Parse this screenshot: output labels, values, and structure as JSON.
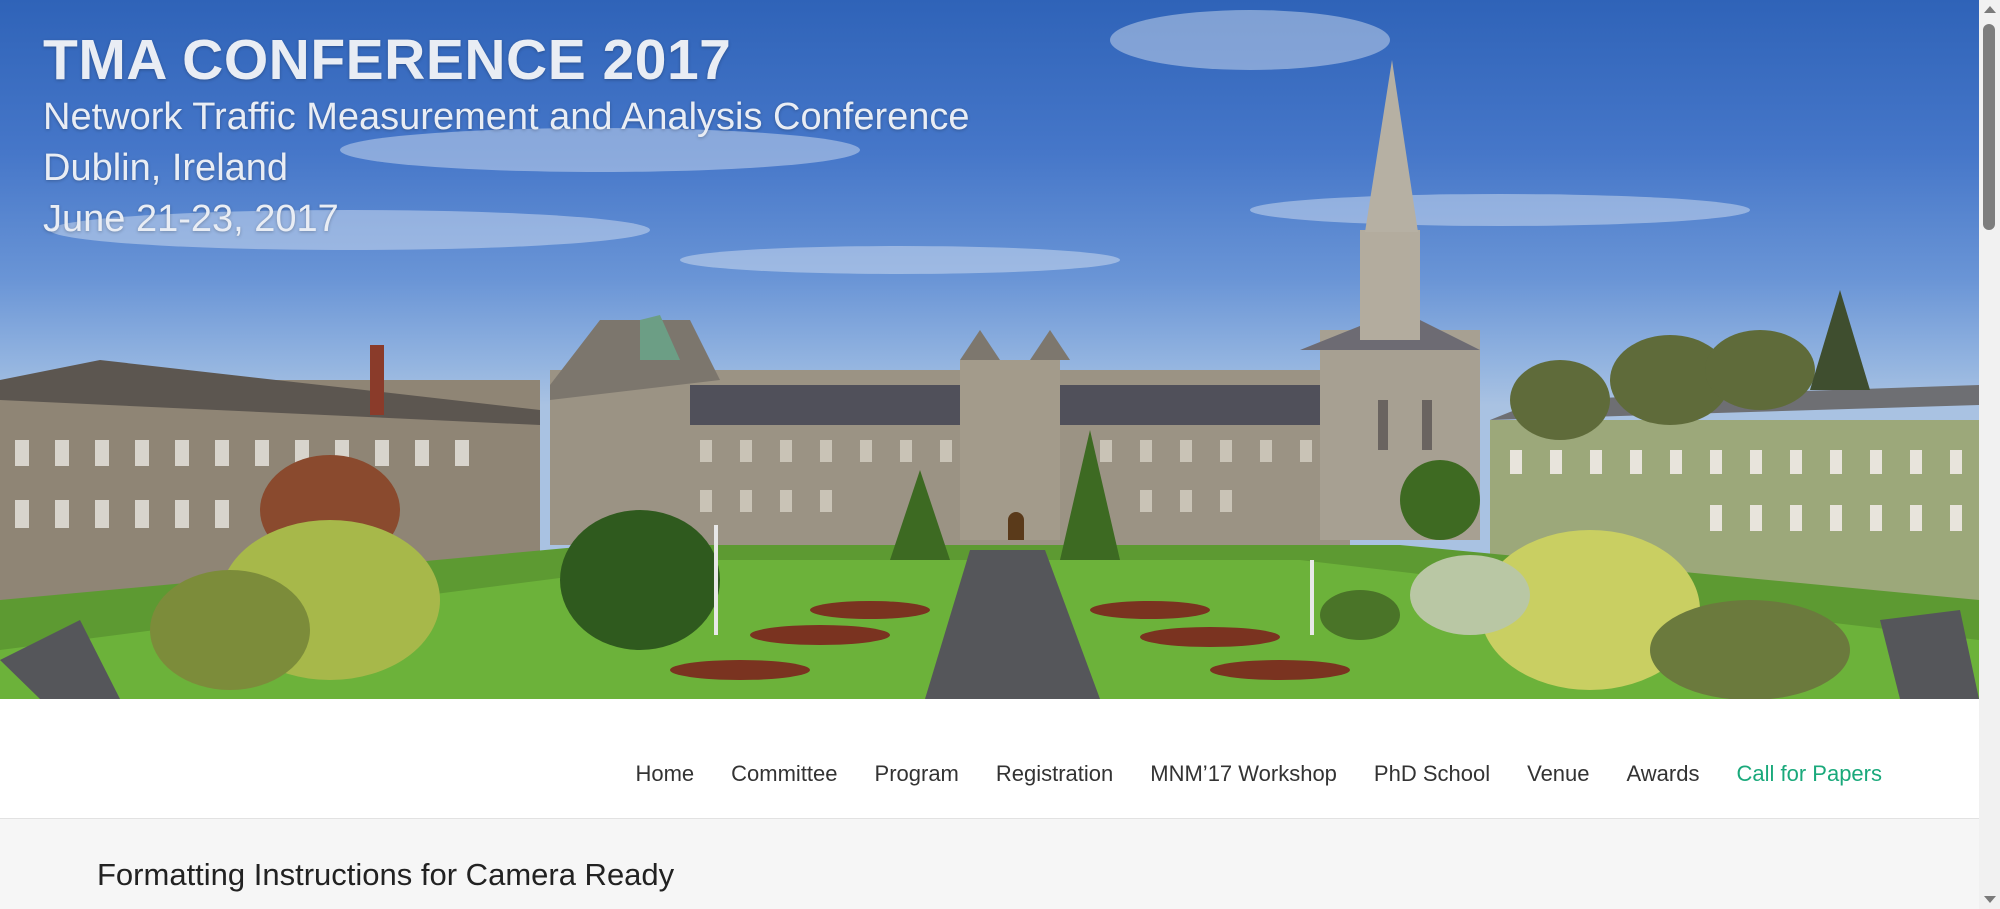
{
  "hero": {
    "title": "TMA CONFERENCE 2017",
    "subtitle": "Network Traffic Measurement and Analysis Conference",
    "location": "Dublin, Ireland",
    "dates": "June 21-23, 2017",
    "image": "campus-panorama-image"
  },
  "nav": {
    "items": [
      {
        "label": "Home"
      },
      {
        "label": "Committee"
      },
      {
        "label": "Program"
      },
      {
        "label": "Registration"
      },
      {
        "label": "MNM’17 Workshop"
      },
      {
        "label": "PhD School"
      },
      {
        "label": "Venue"
      },
      {
        "label": "Awards"
      },
      {
        "label": "Call for Papers",
        "active": true
      }
    ],
    "active_color": "#1aa97b"
  },
  "content": {
    "title": "Formatting Instructions for Camera Ready"
  }
}
